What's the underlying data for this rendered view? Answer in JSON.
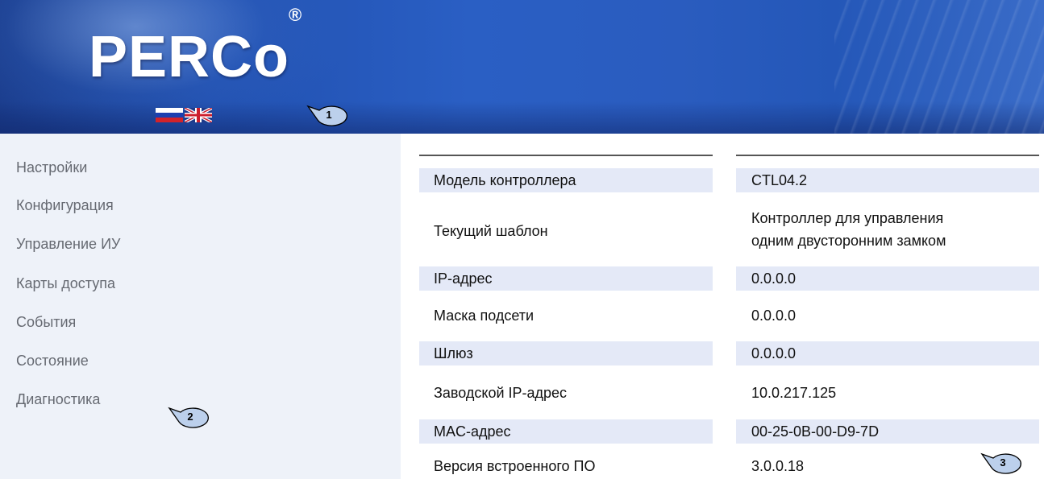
{
  "header": {
    "logo_text": "PERCo",
    "registered_mark": "®",
    "languages": [
      {
        "code": "ru",
        "icon": "russian-flag-icon"
      },
      {
        "code": "en",
        "icon": "uk-flag-icon"
      }
    ],
    "callout_label": "1"
  },
  "sidebar": {
    "items": [
      {
        "label": "Настройки"
      },
      {
        "label": "Конфигурация"
      },
      {
        "label": "Управление ИУ"
      },
      {
        "label": "Карты доступа"
      },
      {
        "label": "События"
      },
      {
        "label": "Состояние"
      },
      {
        "label": "Диагностика"
      }
    ],
    "callout_label": "2"
  },
  "info_table": {
    "rows": [
      {
        "label": "Модель контроллера",
        "value": "CTL04.2",
        "shaded": true
      },
      {
        "label": "Текущий шаблон",
        "value": "Контроллер для управления",
        "value_line2": "одним двусторонним замком",
        "shaded": false
      },
      {
        "label": "IP-адрес",
        "value": "0.0.0.0",
        "shaded": true
      },
      {
        "label": "Маска подсети",
        "value": "0.0.0.0",
        "shaded": false
      },
      {
        "label": "Шлюз",
        "value": "0.0.0.0",
        "shaded": true
      },
      {
        "label": "Заводской IP-адрес",
        "value": "10.0.217.125",
        "shaded": false
      },
      {
        "label": "MAC-адрес",
        "value": "00-25-0B-00-D9-7D",
        "shaded": true
      },
      {
        "label": "Версия встроенного ПО",
        "value": "3.0.0.18",
        "shaded": false
      }
    ],
    "callout_label": "3"
  },
  "colors": {
    "header_blue": "#2a5cbf",
    "sidebar_bg": "#eef2f9",
    "row_shade": "#e4e9f7",
    "nav_text": "#666a72",
    "callout_fill": "#bcd0ec"
  }
}
